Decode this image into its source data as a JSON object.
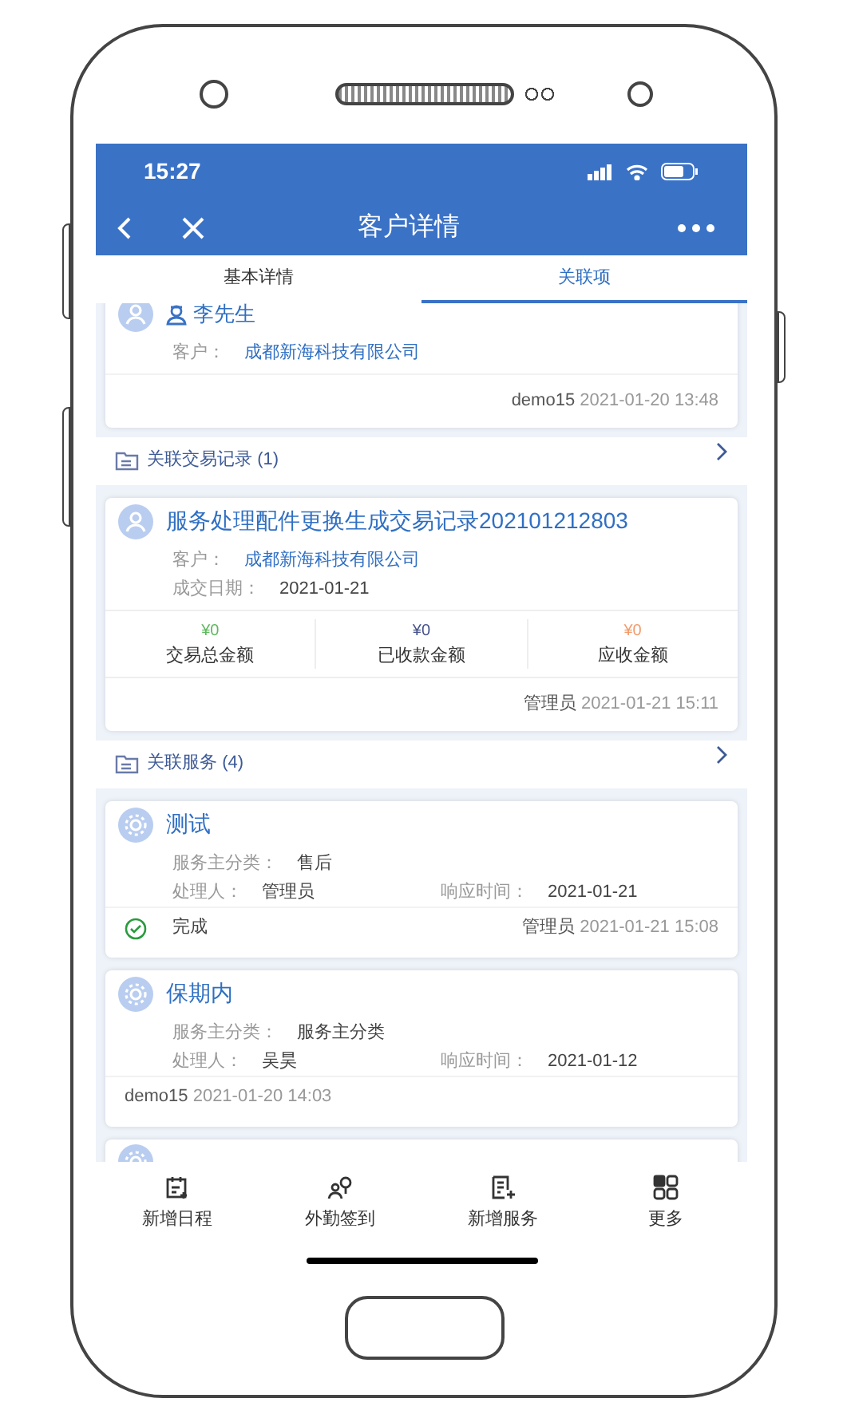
{
  "status_bar": {
    "time": "15:27"
  },
  "header": {
    "title": "客户详情"
  },
  "tabs": [
    {
      "label": "基本详情",
      "selected": false
    },
    {
      "label": "关联项",
      "selected": true
    }
  ],
  "contact_card": {
    "name": "李先生",
    "fields": [
      {
        "label": "客户：",
        "value": "成都新海科技有限公司",
        "link": true
      }
    ],
    "footer_user": "demo15",
    "footer_time": "2021-01-20 13:48"
  },
  "sections": [
    {
      "title": "关联交易记录",
      "count": "(1)",
      "items": [
        {
          "kind": "trade",
          "title": "服务处理配件更换生成交易记录202101212803",
          "fields": [
            {
              "label": "客户：",
              "value": "成都新海科技有限公司",
              "link": true
            },
            {
              "label": "成交日期：",
              "value": "2021-01-21",
              "link": false
            }
          ],
          "amounts": [
            {
              "value": "¥0",
              "label": "交易总金额",
              "color": "#5cb85c"
            },
            {
              "value": "¥0",
              "label": "已收款金额",
              "color": "#44508a"
            },
            {
              "value": "¥0",
              "label": "应收金额",
              "color": "#f29a6a"
            }
          ],
          "footer_user": "管理员",
          "footer_time": "2021-01-21 15:11"
        }
      ]
    },
    {
      "title": "关联服务",
      "count": "(4)",
      "items": [
        {
          "kind": "service",
          "title": "测试",
          "category_label": "服务主分类：",
          "category": "售后",
          "handler_label": "处理人：",
          "handler": "管理员",
          "response_label": "响应时间：",
          "response": "2021-01-21",
          "status": {
            "label": "完成",
            "done": true
          },
          "footer_user": "管理员",
          "footer_time": "2021-01-21 15:08"
        },
        {
          "kind": "service",
          "title": "保期内",
          "category_label": "服务主分类：",
          "category": "服务主分类",
          "handler_label": "处理人：",
          "handler": "吴昊",
          "response_label": "响应时间：",
          "response": "2021-01-12",
          "footer_user": "demo15",
          "footer_time": "2021-01-20 14:03"
        }
      ]
    }
  ],
  "bottom_nav": [
    {
      "label": "新增日程"
    },
    {
      "label": "外勤签到"
    },
    {
      "label": "新增服务"
    },
    {
      "label": "更多"
    }
  ]
}
